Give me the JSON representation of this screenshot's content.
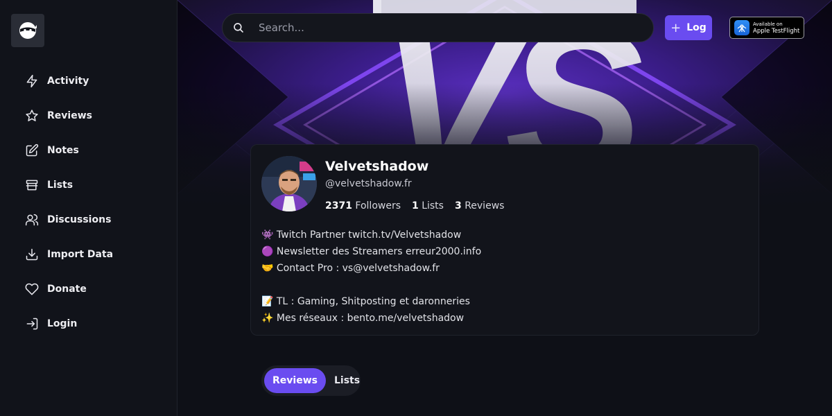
{
  "sidebar": {
    "logo_icon": "ninja-mask-icon",
    "items": [
      {
        "label": "Activity",
        "icon": "bolt-icon"
      },
      {
        "label": "Reviews",
        "icon": "star-icon"
      },
      {
        "label": "Notes",
        "icon": "edit-icon"
      },
      {
        "label": "Lists",
        "icon": "archive-icon"
      },
      {
        "label": "Discussions",
        "icon": "users-icon"
      },
      {
        "label": "Import Data",
        "icon": "download-icon"
      },
      {
        "label": "Donate",
        "icon": "heart-icon"
      },
      {
        "label": "Login",
        "icon": "login-icon"
      }
    ]
  },
  "header": {
    "search_placeholder": "Search...",
    "log_label": "Log",
    "testflight_line1": "Available on",
    "testflight_line2": "Apple TestFlight"
  },
  "banner": {
    "text": "VS"
  },
  "profile": {
    "name": "Velvetshadow",
    "handle": "@velvetshadow.fr",
    "followers_count": "2371",
    "followers_label": "Followers",
    "lists_count": "1",
    "lists_label": "Lists",
    "reviews_count": "3",
    "reviews_label": "Reviews",
    "bio": [
      "👾 Twitch Partner twitch.tv/Velvetshadow",
      "🟣 Newsletter des Streamers erreur2000.info",
      "🤝 Contact Pro : vs@velvetshadow.fr",
      "",
      "📝 TL : Gaming, Shitposting et daronneries",
      "✨ Mes réseaux : bento.me/velvetshadow"
    ]
  },
  "tabs": [
    {
      "label": "Reviews",
      "active": true
    },
    {
      "label": "Lists",
      "active": false
    }
  ],
  "colors": {
    "accent": "#6a4cf0",
    "background": "#0e1017",
    "sidebar": "#11131a"
  }
}
